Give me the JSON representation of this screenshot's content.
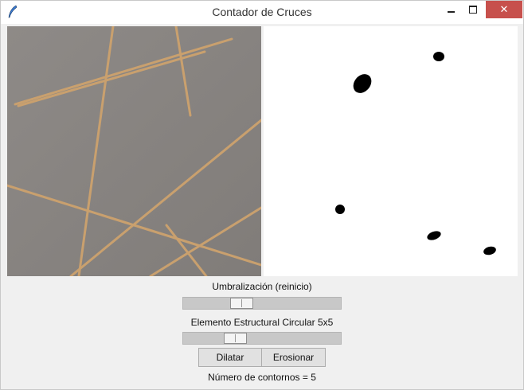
{
  "window": {
    "title": "Contador de Cruces",
    "controls": {
      "minimize": "minimize-icon",
      "maximize": "maximize-icon",
      "close": "close-icon"
    }
  },
  "images": {
    "original": "camera-image",
    "processed": "binary-image"
  },
  "controls": {
    "threshold_label": "Umbralización (reinicio)",
    "threshold_level": 0.35,
    "kernel_label": "Elemento Estructural Circular 5x5",
    "kernel_level": 0.3,
    "dilate_label": "Dilatar",
    "erode_label": "Erosionar"
  },
  "status": {
    "contours_text": "Número de contornos = 5"
  },
  "colors": {
    "titlebar": "#ffffff",
    "close_button": "#c7504c",
    "window_bg": "#f0f0f0",
    "stick": "#c79a66"
  }
}
